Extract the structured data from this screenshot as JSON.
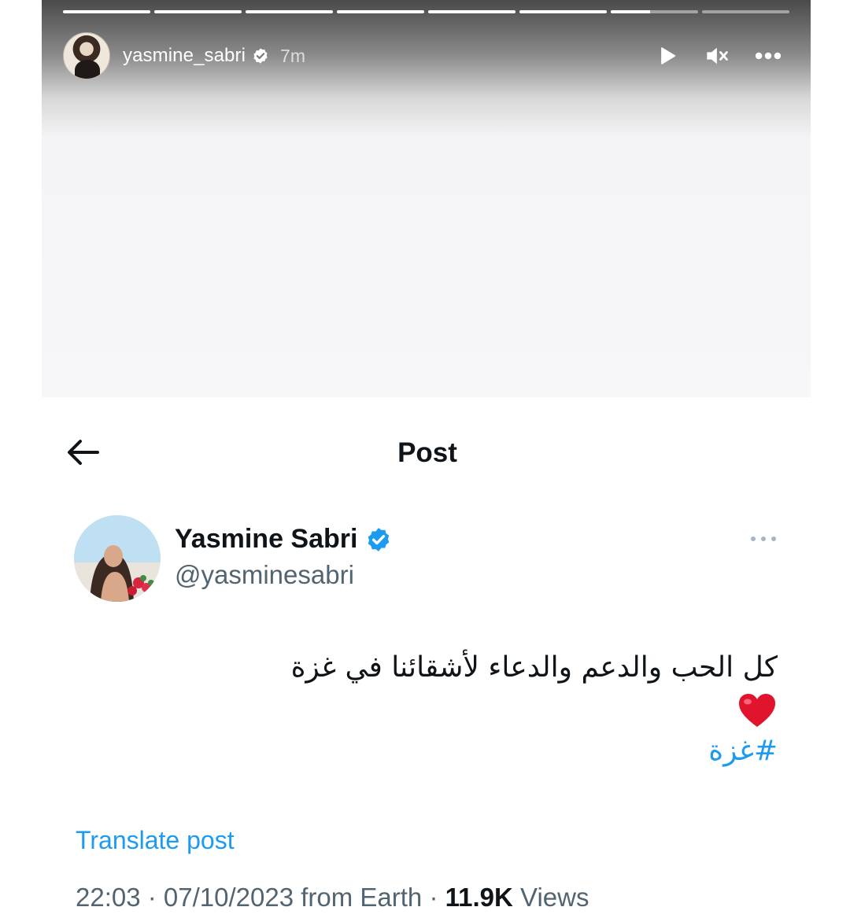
{
  "story": {
    "progress_segments": [
      1,
      1,
      1,
      1,
      1,
      1,
      0.45,
      0
    ],
    "username": "yasmine_sabri",
    "time_ago": "7m",
    "icons": [
      "play-icon",
      "mute-icon",
      "more-icon"
    ]
  },
  "post_header": {
    "title": "Post"
  },
  "author": {
    "name": "Yasmine Sabri",
    "handle": "@yasminesabri",
    "verified": true
  },
  "post": {
    "text": "كل الحب والدعم والدعاء لأشقائنا في غزة",
    "emoji": "heart",
    "hashtag": "#غزة",
    "translate_label": "Translate post",
    "timestamp": "22:03 · 07/10/2023 from Earth · ",
    "views_count": "11.9K",
    "views_label": " Views"
  },
  "colors": {
    "accent": "#1d9bf0",
    "text_primary": "#0f1419",
    "text_secondary": "#536471",
    "heart": "#e0152d"
  }
}
